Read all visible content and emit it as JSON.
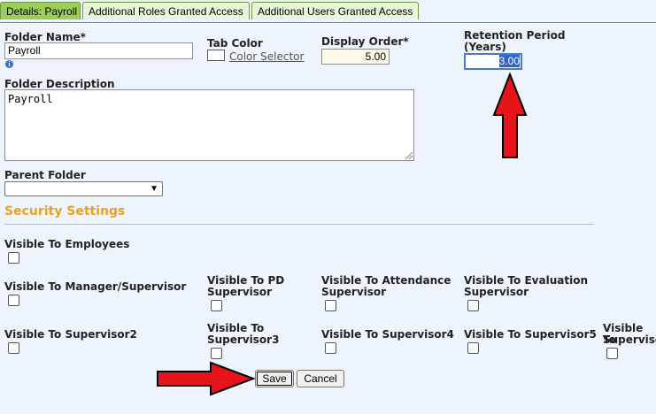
{
  "tabs": [
    {
      "label": "Details: Payroll"
    },
    {
      "label": "Additional Roles Granted Access"
    },
    {
      "label": "Additional Users Granted Access"
    }
  ],
  "form": {
    "folder_name_label": "Folder Name*",
    "folder_name_value": "Payroll",
    "tab_color_label": "Tab Color",
    "color_selector_link": "Color Selector",
    "display_order_label": "Display Order*",
    "display_order_value": "5.00",
    "retention_label_line1": "Retention Period",
    "retention_label_line2": "(Years)",
    "retention_value": "3.00",
    "folder_description_label": "Folder Description",
    "folder_description_value": "Payroll",
    "parent_folder_label": "Parent Folder",
    "parent_folder_value": ""
  },
  "security": {
    "title": "Security Settings",
    "visible_employees": "Visible To Employees",
    "visible_manager": "Visible To Manager/Supervisor",
    "visible_pd_1": "Visible To PD",
    "visible_pd_2": "Supervisor",
    "visible_attendance_1": "Visible To Attendance",
    "visible_attendance_2": "Supervisor",
    "visible_evaluation_1": "Visible To Evaluation",
    "visible_evaluation_2": "Supervisor",
    "visible_sup2": "Visible To Supervisor2",
    "visible_sup3_1": "Visible To",
    "visible_sup3_2": "Supervisor3",
    "visible_sup4": "Visible To Supervisor4",
    "visible_sup5": "Visible To Supervisor5",
    "visible_sup6_1": "Visible To",
    "visible_sup6_2": "Supervisor"
  },
  "buttons": {
    "save": "Save",
    "cancel": "Cancel"
  },
  "colors": {
    "annotation_arrow": "#e8141c",
    "section_title": "#f0a020",
    "active_tab": "#9ccd5a"
  }
}
